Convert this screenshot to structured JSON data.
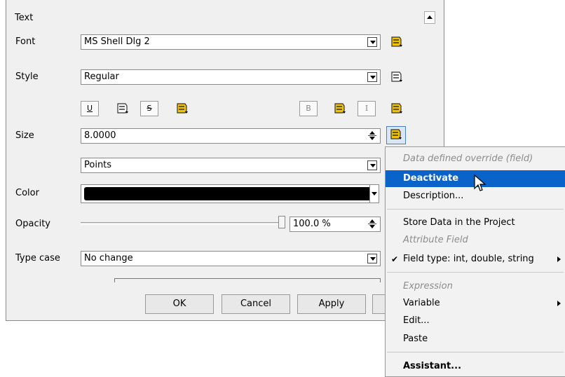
{
  "section_title": "Text",
  "font": {
    "label": "Font",
    "value": "MS Shell Dlg 2"
  },
  "style": {
    "label": "Style",
    "value": "Regular"
  },
  "format_buttons": {
    "underline": "U",
    "strike": "S",
    "bold": "B",
    "italic": "I"
  },
  "size": {
    "label": "Size",
    "value": "8.0000",
    "unit": "Points"
  },
  "color": {
    "label": "Color",
    "value": "#000000"
  },
  "opacity": {
    "label": "Opacity",
    "value": "100.0 %",
    "level": 1.0
  },
  "type_case": {
    "label": "Type case",
    "value": "No change"
  },
  "buttons": {
    "ok": "OK",
    "cancel": "Cancel",
    "apply": "Apply"
  },
  "menu": {
    "header": "Data defined override (field)",
    "deactivate": "Deactivate",
    "description": "Description...",
    "store": "Store Data in the Project",
    "attribute_field": "Attribute Field",
    "field_type": "Field type: int, double, string",
    "expression": "Expression",
    "variable": "Variable",
    "edit": "Edit...",
    "paste": "Paste",
    "assistant": "Assistant..."
  },
  "colors": {
    "highlight": "#0a63c9",
    "dd_icon_active": "#f2c200",
    "dd_icon_inactive": "#ffffff"
  }
}
